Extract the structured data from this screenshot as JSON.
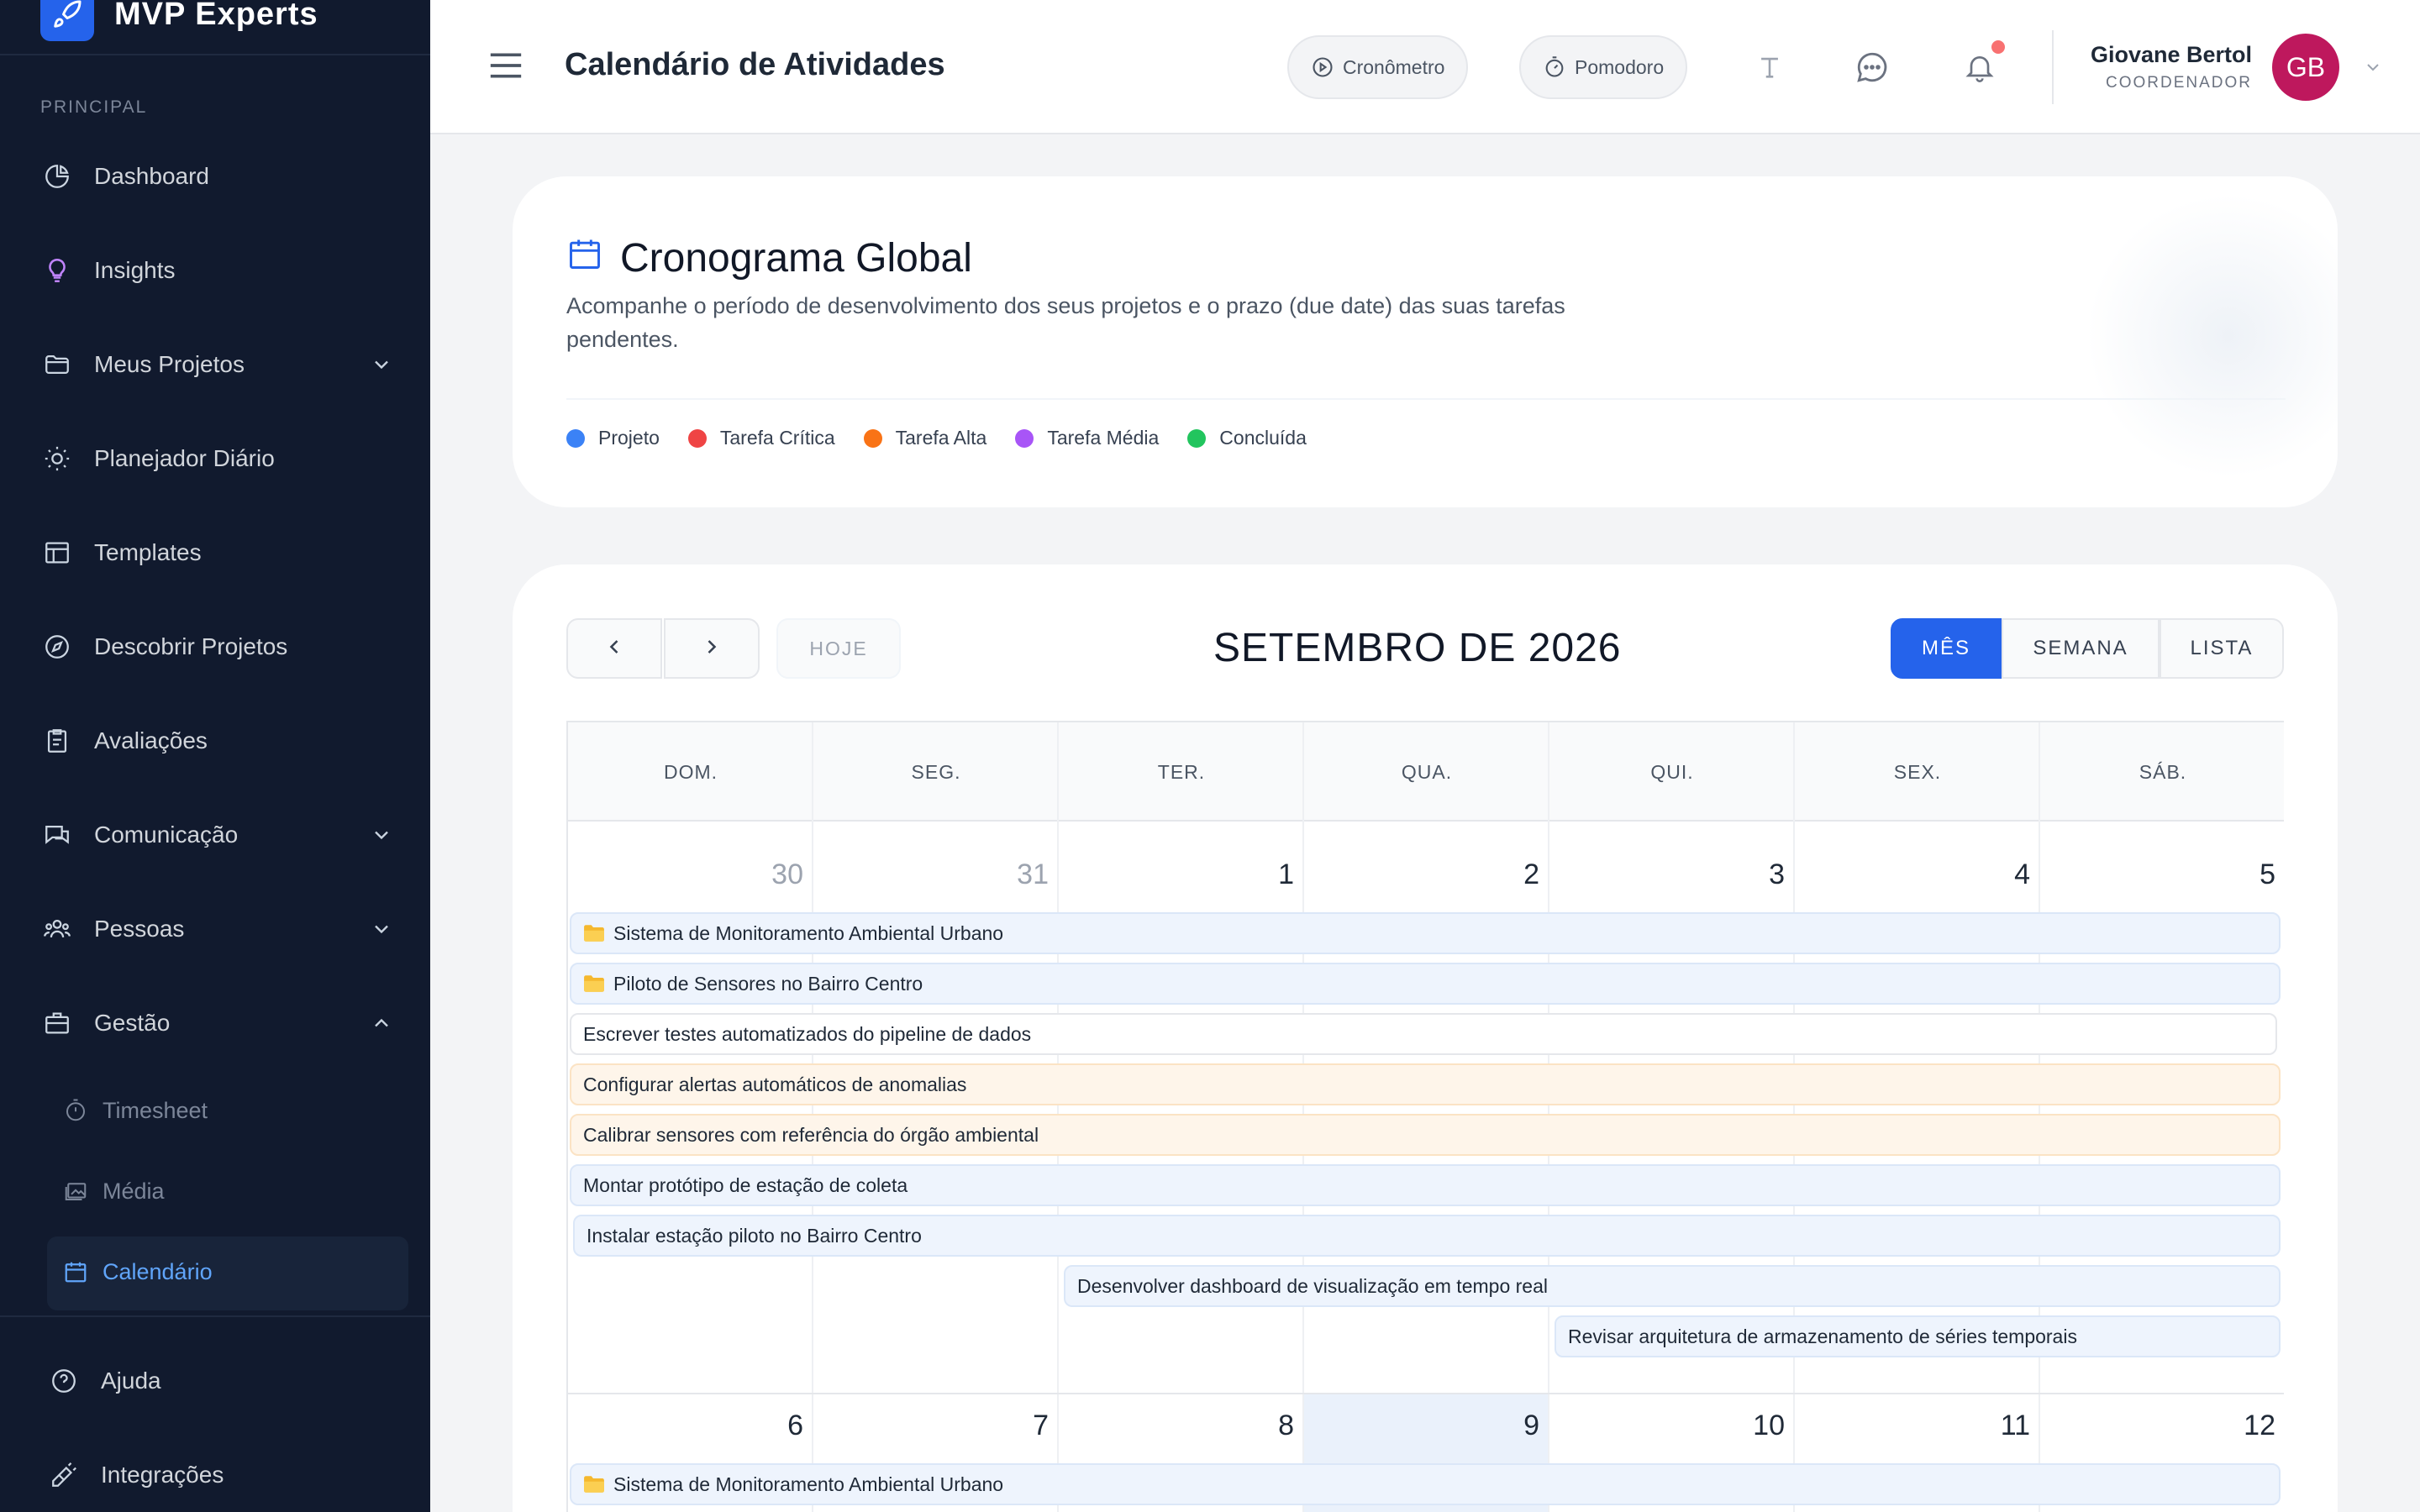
{
  "brand": {
    "name": "MVP Experts"
  },
  "sidebar": {
    "section_label": "PRINCIPAL",
    "items": [
      {
        "label": "Dashboard",
        "icon": "chart-pie-icon"
      },
      {
        "label": "Insights",
        "icon": "lightbulb-icon"
      },
      {
        "label": "Meus Projetos",
        "icon": "folder-icon",
        "expandable": true
      },
      {
        "label": "Planejador Diário",
        "icon": "sun-icon"
      },
      {
        "label": "Templates",
        "icon": "layout-icon"
      },
      {
        "label": "Descobrir Projetos",
        "icon": "compass-icon"
      },
      {
        "label": "Avaliações",
        "icon": "clipboard-icon"
      },
      {
        "label": "Comunicação",
        "icon": "chat-icon",
        "expandable": true
      },
      {
        "label": "Pessoas",
        "icon": "users-icon",
        "expandable": true
      },
      {
        "label": "Gestão",
        "icon": "briefcase-icon",
        "expanded": true
      }
    ],
    "sub_items": [
      {
        "label": "Timesheet",
        "icon": "stopwatch-icon"
      },
      {
        "label": "Média",
        "icon": "images-icon"
      },
      {
        "label": "Calendário",
        "icon": "calendar-icon",
        "active": true
      }
    ],
    "footer_items": [
      {
        "label": "Ajuda",
        "icon": "help-circle-icon"
      },
      {
        "label": "Integrações",
        "icon": "plug-icon"
      }
    ]
  },
  "header": {
    "title": "Calendário de Atividades",
    "cronometro_label": "Cronômetro",
    "pomodoro_label": "Pomodoro",
    "user_name": "Giovane Bertol",
    "user_role": "COORDENADOR",
    "user_initials": "GB"
  },
  "overview": {
    "title": "Cronograma Global",
    "description": "Acompanhe o período de desenvolvimento dos seus projetos e o prazo (due date) das suas tarefas pendentes.",
    "legend": [
      {
        "label": "Projeto",
        "color": "#3b82f6"
      },
      {
        "label": "Tarefa Crítica",
        "color": "#ef4444"
      },
      {
        "label": "Tarefa Alta",
        "color": "#f97316"
      },
      {
        "label": "Tarefa Média",
        "color": "#a855f7"
      },
      {
        "label": "Concluída",
        "color": "#22c55e"
      }
    ]
  },
  "calendar": {
    "title": "SETEMBRO DE 2026",
    "today_label": "HOJE",
    "views": {
      "month": "MÊS",
      "week": "SEMANA",
      "list": "LISTA"
    },
    "weekdays": [
      "DOM.",
      "SEG.",
      "TER.",
      "QUA.",
      "QUI.",
      "SEX.",
      "SÁB."
    ],
    "week1_days": [
      "30",
      "31",
      "1",
      "2",
      "3",
      "4",
      "5"
    ],
    "week2_days": [
      "6",
      "7",
      "8",
      "9",
      "10",
      "11",
      "12"
    ],
    "week1_events": [
      {
        "label": "Sistema de Monitoramento Ambiental Urbano",
        "type": "project"
      },
      {
        "label": "Piloto de Sensores no Bairro Centro",
        "type": "project"
      },
      {
        "label": "Escrever testes automatizados do pipeline de dados",
        "type": "task"
      },
      {
        "label": "Configurar alertas automáticos de anomalias",
        "type": "high"
      },
      {
        "label": "Calibrar sensores com referência do órgão ambiental",
        "type": "high"
      },
      {
        "label": "Montar protótipo de estação de coleta",
        "type": "task"
      },
      {
        "label": "Instalar estação piloto no Bairro Centro",
        "type": "task"
      },
      {
        "label": "Desenvolver dashboard de visualização em tempo real",
        "type": "task"
      },
      {
        "label": "Revisar arquitetura de armazenamento de séries temporais",
        "type": "task"
      }
    ],
    "week2_events": [
      {
        "label": "Sistema de Monitoramento Ambiental Urbano",
        "type": "project"
      }
    ]
  }
}
